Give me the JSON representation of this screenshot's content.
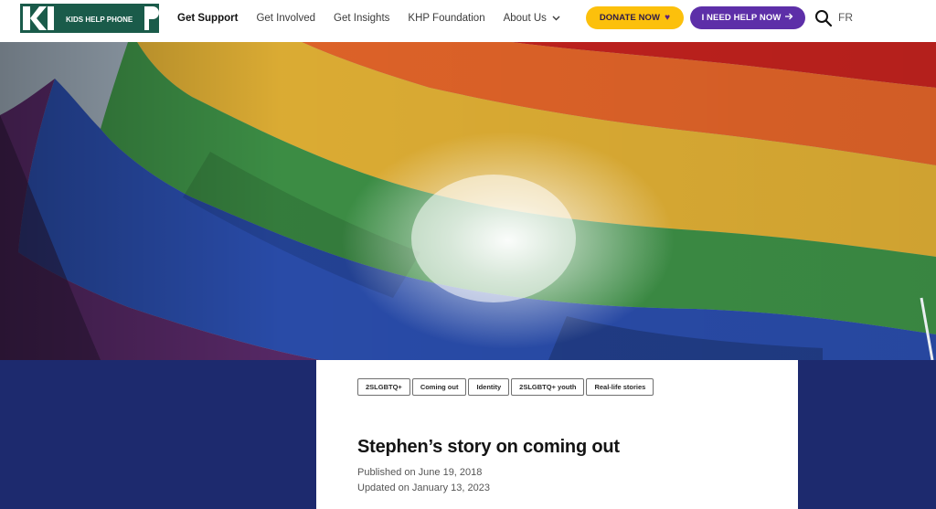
{
  "header": {
    "logo_text": "KHP",
    "logo_subtext": "KIDS HELP PHONE",
    "nav": [
      {
        "label": "Get Support",
        "active": true
      },
      {
        "label": "Get Involved",
        "active": false
      },
      {
        "label": "Get Insights",
        "active": false
      },
      {
        "label": "KHP Foundation",
        "active": false
      },
      {
        "label": "About Us",
        "active": false,
        "dropdown": true
      }
    ],
    "donate_label": "DONATE NOW",
    "help_label": "I NEED HELP NOW",
    "language_label": "FR",
    "icons": {
      "donate": "heart-icon",
      "help": "arrow-right-icon",
      "search": "search-icon",
      "about_dropdown": "chevron-down-icon"
    },
    "colors": {
      "brand": "#1a5b4a",
      "donate": "#fcc00c",
      "help": "#5d2fa8"
    }
  },
  "hero": {
    "image": "rainbow-pride-flag-photo"
  },
  "article": {
    "tags": [
      "2SLGBTQ+",
      "Coming out",
      "Identity",
      "2SLGBTQ+ youth",
      "Real-life stories"
    ],
    "title": "Stephen’s story on coming out",
    "published": "Published on June 19, 2018",
    "updated": "Updated on January 13, 2023",
    "colors": {
      "band": "#1d2a6e"
    }
  }
}
